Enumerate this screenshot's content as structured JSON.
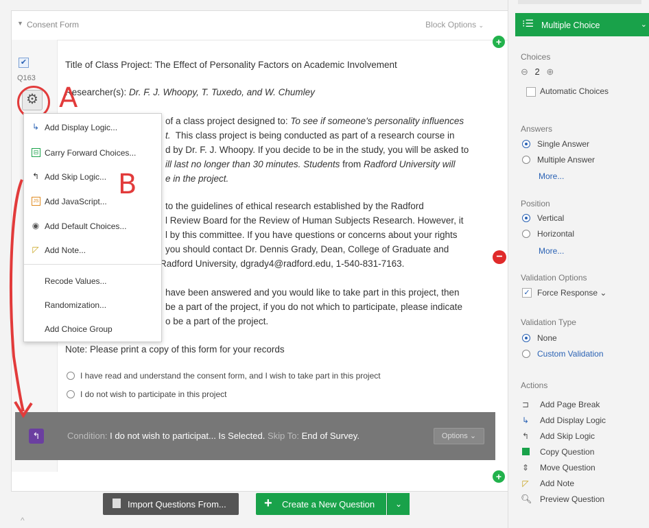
{
  "block": {
    "title": "Consent Form",
    "options_label": "Block Options"
  },
  "question": {
    "id": "Q163",
    "title": "Title of Class Project: The Effect of Personality Factors on Academic Involvement",
    "researchers_label": "Researcher(s):",
    "researchers": "Dr. F. J. Whoopy, T. Tuxedo, and W. Chumley",
    "p1a": "of a class project designed to:",
    "p1a_italic": "To see if someone's personality influences",
    "p1b_italic": "t.",
    "p1b": "This class project is being conducted as part of a research course in",
    "p1c": "d by Dr. F. J. Whoopy. If you decide to be in the study, you will be asked to",
    "p1d_italic": "ill last no longer than 30 minutes. Students",
    "p1d": "from",
    "p1d_italic2": "Radford University will",
    "p1e_italic": "e in the project.",
    "p2a": "to the guidelines of ethical research established by the Radford",
    "p2b": "l Review Board for the Review of Human Subjects Research. However, it",
    "p2c": "l by this committee. If you have questions or concerns about your rights",
    "p2d": "you should contact Dr. Dennis Grady, Dean, College of Graduate and",
    "p2e": "Radford University, dgrady4@radford.edu, 1-540-831-7163.",
    "p3a": "have been answered and you would like to take part in this project, then",
    "p3b": "be a part of the project, if you do not which to participate, please indicate",
    "p3c": "o be a part of the project.",
    "note": "Note:  Please print a copy of this form for your records",
    "choices": [
      "I have read and understand the consent form, and I wish to take part in this project",
      "I do not wish to participate in this project"
    ]
  },
  "menu": {
    "items": [
      {
        "label": "Add Display Logic...",
        "icon": "display-logic-icon"
      },
      {
        "label": "Carry Forward Choices...",
        "icon": "carry-forward-icon"
      },
      {
        "label": "Add Skip Logic...",
        "icon": "skip-logic-icon"
      },
      {
        "label": "Add JavaScript...",
        "icon": "javascript-icon"
      },
      {
        "label": "Add Default Choices...",
        "icon": "default-choices-icon"
      },
      {
        "label": "Add Note...",
        "icon": "note-icon"
      },
      {
        "label": "Recode Values..."
      },
      {
        "label": "Randomization..."
      },
      {
        "label": "Add Choice Group"
      }
    ]
  },
  "condition": {
    "prefix": "Condition:",
    "text": "I do not wish to participat... Is Selected.",
    "skip_prefix": "Skip To:",
    "skip_target": "End of Survey.",
    "options_label": "Options"
  },
  "buttons": {
    "import_label": "Import Questions From...",
    "create_label": "Create a New Question"
  },
  "panel": {
    "qtype": "Multiple Choice",
    "choices_head": "Choices",
    "choices_count": "2",
    "automatic_choices": "Automatic Choices",
    "answers_head": "Answers",
    "single_answer": "Single Answer",
    "multiple_answer": "Multiple Answer",
    "more1": "More...",
    "position_head": "Position",
    "vertical": "Vertical",
    "horizontal": "Horizontal",
    "more2": "More...",
    "validation_options_head": "Validation Options",
    "force_response": "Force Response",
    "validation_type_head": "Validation Type",
    "none": "None",
    "custom_validation": "Custom Validation",
    "actions_head": "Actions",
    "actions": [
      {
        "label": "Add Page Break",
        "icon": "page-break-icon"
      },
      {
        "label": "Add Display Logic",
        "icon": "display-logic-icon"
      },
      {
        "label": "Add Skip Logic",
        "icon": "skip-logic-icon"
      },
      {
        "label": "Copy Question",
        "icon": "copy-icon"
      },
      {
        "label": "Move Question",
        "icon": "move-icon"
      },
      {
        "label": "Add Note",
        "icon": "note-icon"
      },
      {
        "label": "Preview Question",
        "icon": "preview-icon"
      }
    ]
  },
  "annotations": {
    "label_a": "A",
    "label_b": "B",
    "color": "#e23b3b"
  },
  "colors": {
    "green": "#19a24a",
    "purple": "#6b3fa0",
    "blue": "#2a62b4"
  }
}
